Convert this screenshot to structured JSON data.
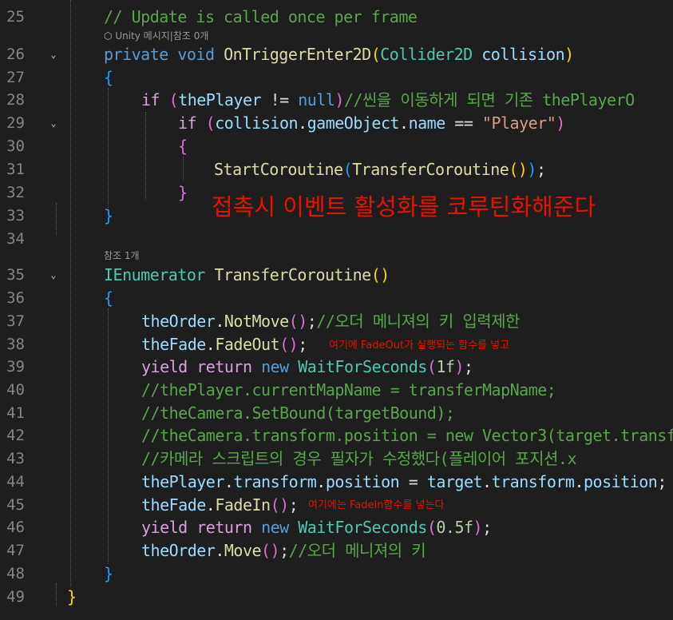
{
  "colors": {
    "background": "#1e1e1e",
    "line_number": "#858585",
    "keyword": "#569cd6",
    "control_keyword": "#d8a0df",
    "type": "#4ec9b0",
    "function": "#dcdcaa",
    "identifier": "#9cdcfe",
    "comment": "#57a64a",
    "string": "#d69d85",
    "number": "#b5cea8",
    "annotation": "#e51400"
  },
  "line_numbers": {
    "l25": "25",
    "l26": "26",
    "l27": "27",
    "l28": "28",
    "l29": "29",
    "l30": "30",
    "l31": "31",
    "l32": "32",
    "l33": "33",
    "l34": "34",
    "l35": "35",
    "l36": "36",
    "l37": "37",
    "l38": "38",
    "l39": "39",
    "l40": "40",
    "l41": "41",
    "l42": "42",
    "l43": "43",
    "l44": "44",
    "l45": "45",
    "l46": "46",
    "l47": "47",
    "l48": "48",
    "l49": "49"
  },
  "codelens": {
    "unity_refs": "Unity 메시지|참조 0개",
    "refs_one": "참조 1개"
  },
  "fold_icons": [
    "chevron-down-icon"
  ],
  "code": {
    "l25_comment": "// Update is called once per frame",
    "l26_private": "private",
    "l26_void": "void",
    "l26_fn": "OnTriggerEnter2D",
    "l26_type": "Collider2D",
    "l26_param": "collision",
    "l28_if": "if",
    "l28_var": "thePlayer",
    "l28_op": " != ",
    "l28_null": "null",
    "l28_comment": "//씬을 이동하게 되면 기존 thePlayerO",
    "l29_if": "if",
    "l29_var": "collision",
    "l29_member": "gameObject",
    "l29_prop": "name",
    "l29_op": " == ",
    "l29_str": "\"Player\"",
    "l31_fn": "StartCoroutine",
    "l31_arg": "TransferCoroutine",
    "l35_type": "IEnumerator",
    "l35_fn": "TransferCoroutine",
    "l37_var": "theOrder",
    "l37_fn": "NotMove",
    "l37_comment": "//오더 메니져의 키 입력제한",
    "l38_var": "theFade",
    "l38_fn": "FadeOut",
    "l39_yield": "yield",
    "l39_return": "return",
    "l39_new": "new",
    "l39_type": "WaitForSeconds",
    "l39_num": "1f",
    "l40_comment": "//thePlayer.currentMapName = transferMapName;",
    "l41_comment": "//theCamera.SetBound(targetBound);",
    "l42_comment": "//theCamera.transform.position = new Vector3(target.transf",
    "l43_comment": "//카메라 스크립트의 경우 필자가 수정했다(플레이어 포지션.x",
    "l44_var": "thePlayer",
    "l44_p1": "transform",
    "l44_p2": "position",
    "l44_op": " = ",
    "l44_v2": "target",
    "l44_p3": "transform",
    "l44_p4": "position",
    "l45_var": "theFade",
    "l45_fn": "FadeIn",
    "l46_yield": "yield",
    "l46_return": "return",
    "l46_new": "new",
    "l46_type": "WaitForSeconds",
    "l46_num": "0.5f",
    "l47_var": "theOrder",
    "l47_fn": "Move",
    "l47_comment": "//오더 메니져의 키"
  },
  "annotations": {
    "big_note": "접촉시 이벤트 활성화를 코루틴화해준다",
    "fadeout_note": "여기에 FadeOut가 실행되는 함수를 넣고",
    "fadein_note": "여기에는 FadeIn함수를 넣는다"
  }
}
